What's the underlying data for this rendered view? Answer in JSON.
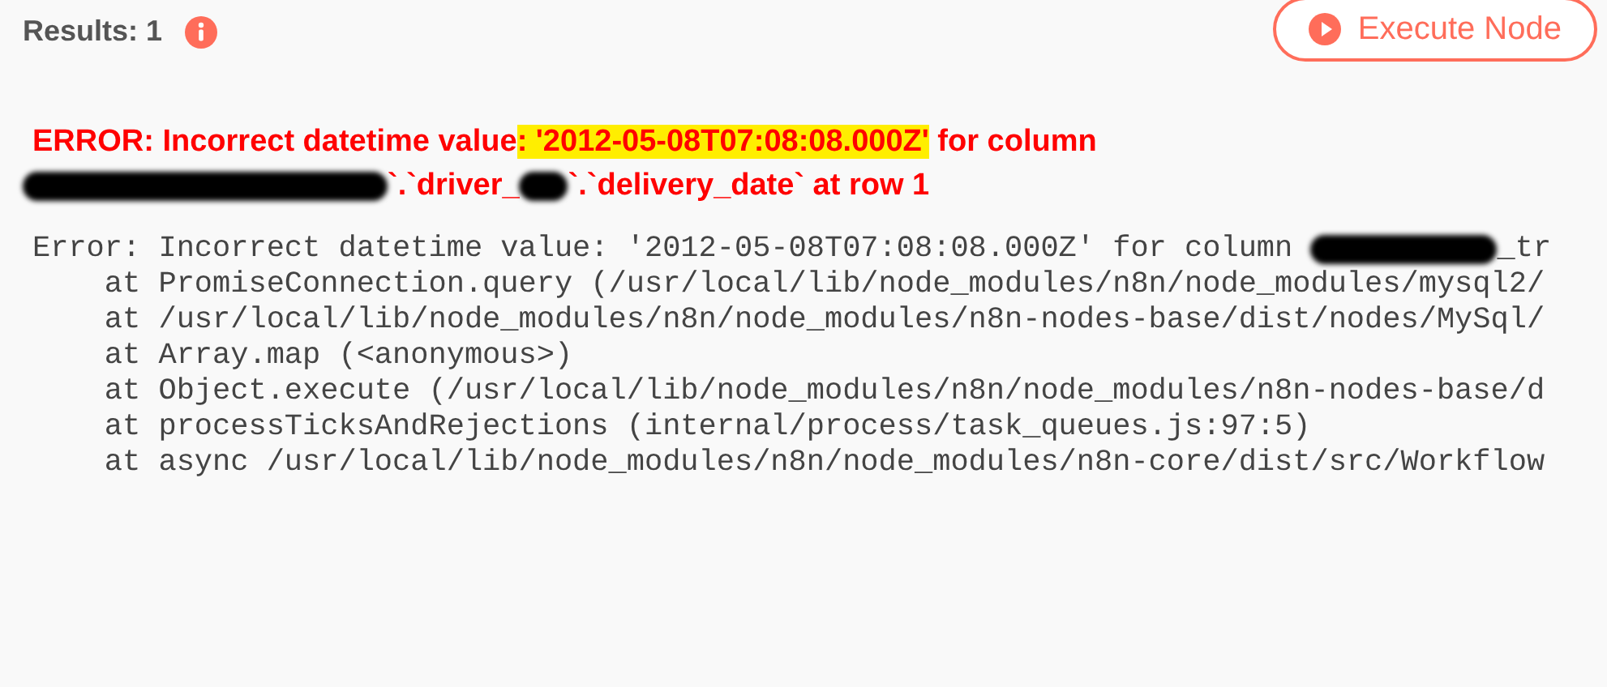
{
  "header": {
    "results_label": "Results: 1",
    "execute_button": "Execute Node"
  },
  "error_heading": {
    "line1": {
      "before": "ERROR: Incorrect datetime value",
      "highlighted": ": '2012-05-08T07:08:08.000Z'",
      "after": " for column"
    },
    "line2": [
      {
        "kind": "redacted"
      },
      {
        "kind": "text",
        "text": "`.`driver_"
      },
      {
        "kind": "redacted"
      },
      {
        "kind": "text",
        "text": "`.`delivery_date` at row 1"
      }
    ]
  },
  "stack_trace": [
    [
      {
        "kind": "text",
        "text": "Error: Incorrect datetime value: '2012-05-08T07:08:08.000Z' for column "
      },
      {
        "kind": "redacted"
      },
      {
        "kind": "text",
        "text": "_tr"
      }
    ],
    [
      {
        "kind": "text",
        "text": "    at PromiseConnection.query (/usr/local/lib/node_modules/n8n/node_modules/mysql2/"
      }
    ],
    [
      {
        "kind": "text",
        "text": "    at /usr/local/lib/node_modules/n8n/node_modules/n8n-nodes-base/dist/nodes/MySql/"
      }
    ],
    [
      {
        "kind": "text",
        "text": "    at Array.map (<anonymous>)"
      }
    ],
    [
      {
        "kind": "text",
        "text": "    at Object.execute (/usr/local/lib/node_modules/n8n/node_modules/n8n-nodes-base/d"
      }
    ],
    [
      {
        "kind": "text",
        "text": "    at processTicksAndRejections (internal/process/task_queues.js:97:5)"
      }
    ],
    [
      {
        "kind": "text",
        "text": "    at async /usr/local/lib/node_modules/n8n/node_modules/n8n-core/dist/src/Workflow"
      }
    ]
  ]
}
